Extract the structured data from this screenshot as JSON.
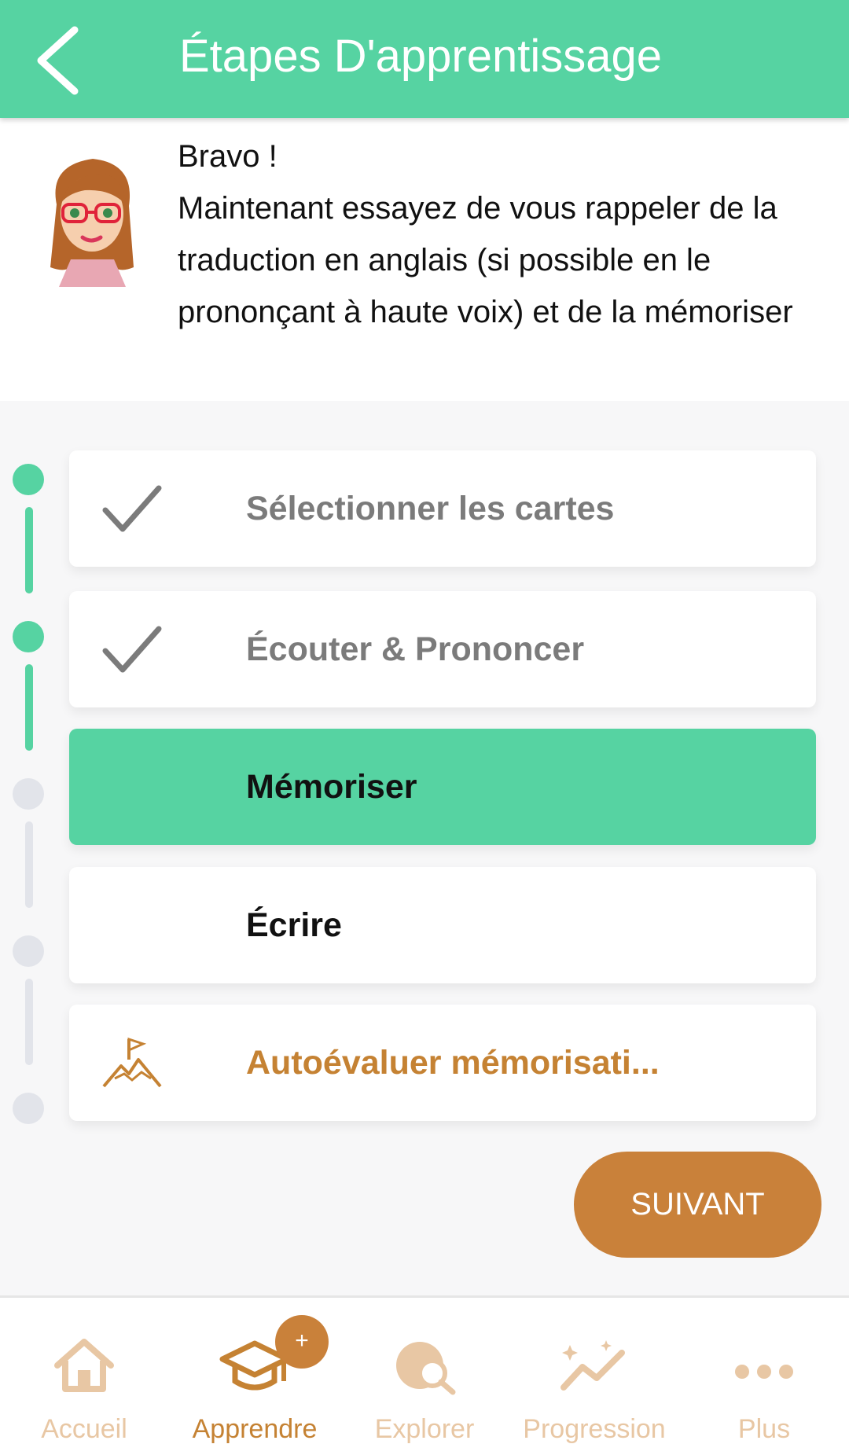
{
  "header": {
    "title": "Étapes D'apprentissage",
    "back_icon": "chevron-left-icon"
  },
  "message": {
    "greeting": "Bravo !",
    "body": "Maintenant essayez de vous rappeler de la traduction en anglais (si possible en le prononçant à haute voix) et de la mémoriser"
  },
  "steps": [
    {
      "label": "Sélectionner les cartes",
      "state": "completed",
      "icon": "check-icon"
    },
    {
      "label": "Écouter & Prononcer",
      "state": "completed",
      "icon": "check-icon"
    },
    {
      "label": "Mémoriser",
      "state": "active"
    },
    {
      "label": "Écrire",
      "state": "pending"
    },
    {
      "label": "Autoévaluer mémorisati...",
      "state": "pending",
      "icon": "mountain-flag-icon"
    }
  ],
  "next_button": {
    "label": "SUIVANT"
  },
  "bottom_nav": {
    "items": [
      {
        "label": "Accueil",
        "icon": "home-icon"
      },
      {
        "label": "Apprendre",
        "icon": "graduation-cap-icon",
        "active": true
      },
      {
        "label": "Explorer",
        "icon": "globe-search-icon"
      },
      {
        "label": "Progression",
        "icon": "progress-chart-icon"
      },
      {
        "label": "Plus",
        "icon": "more-dots-icon"
      }
    ],
    "badge": "+"
  },
  "colors": {
    "primary": "#56d3a2",
    "accent": "#c9813a",
    "inactive_nav": "#e8c7a4",
    "muted": "#7b7b7b"
  }
}
